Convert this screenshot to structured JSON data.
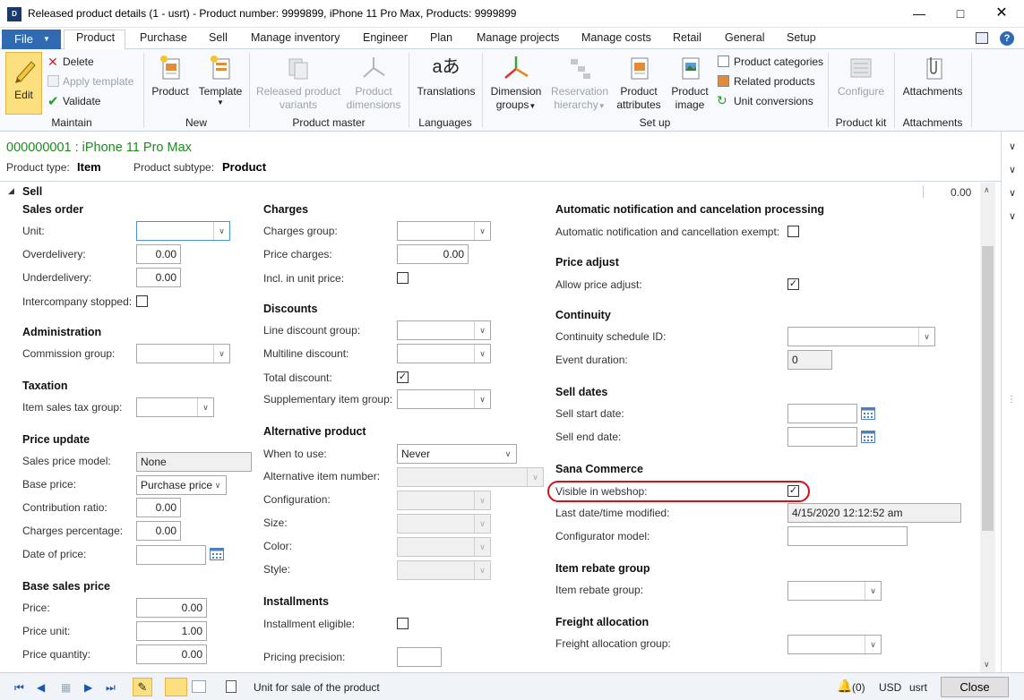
{
  "window": {
    "title": "Released product details (1 - usrt) - Product number: 9999899, iPhone 11 Pro Max, Products: 9999899",
    "icon_label": "D"
  },
  "ribbon_tabs": {
    "file": "File",
    "tabs": [
      "Product",
      "Purchase",
      "Sell",
      "Manage inventory",
      "Engineer",
      "Plan",
      "Manage projects",
      "Manage costs",
      "Retail",
      "General",
      "Setup"
    ]
  },
  "ribbon": {
    "maintain": {
      "label": "Maintain",
      "edit": "Edit",
      "delete": "Delete",
      "apply_template": "Apply template",
      "validate": "Validate"
    },
    "new": {
      "label": "New",
      "product": "Product",
      "template": "Template"
    },
    "product_master": {
      "label": "Product master",
      "variants_1": "Released product",
      "variants_2": "variants",
      "dimensions_1": "Product",
      "dimensions_2": "dimensions"
    },
    "languages": {
      "label": "Languages",
      "translations": "Translations"
    },
    "setup": {
      "label": "Set up",
      "dim_groups_1": "Dimension",
      "dim_groups_2": "groups",
      "res_hier_1": "Reservation",
      "res_hier_2": "hierarchy",
      "attr_1": "Product",
      "attr_2": "attributes",
      "image_1": "Product",
      "image_2": "image",
      "categories": "Product categories",
      "related": "Related products",
      "unit_conv": "Unit conversions"
    },
    "product_kit": {
      "label": "Product kit",
      "configure": "Configure"
    },
    "attachments": {
      "label": "Attachments",
      "attachments": "Attachments"
    }
  },
  "header": {
    "record": "000000001 : iPhone 11 Pro Max",
    "product_type_label": "Product type:",
    "product_type": "Item",
    "product_subtype_label": "Product subtype:",
    "product_subtype": "Product"
  },
  "section": {
    "title": "Sell",
    "total": "0.00"
  },
  "col1": {
    "sales_order": {
      "title": "Sales order",
      "unit": "Unit:",
      "unit_val": "",
      "overdelivery": "Overdelivery:",
      "overdelivery_val": "0.00",
      "underdelivery": "Underdelivery:",
      "underdelivery_val": "0.00",
      "intercompany": "Intercompany stopped:"
    },
    "administration": {
      "title": "Administration",
      "commission": "Commission group:"
    },
    "taxation": {
      "title": "Taxation",
      "item_tax": "Item sales tax group:"
    },
    "price_update": {
      "title": "Price update",
      "model": "Sales price model:",
      "model_val": "None",
      "base": "Base price:",
      "base_val": "Purchase price",
      "contribution": "Contribution ratio:",
      "contribution_val": "0.00",
      "charges_pct": "Charges percentage:",
      "charges_pct_val": "0.00",
      "date": "Date of price:"
    },
    "base_sales_price": {
      "title": "Base sales price",
      "price": "Price:",
      "price_val": "0.00",
      "unit": "Price unit:",
      "unit_val": "1.00",
      "qty": "Price quantity:",
      "qty_val": "0.00"
    }
  },
  "col2": {
    "charges": {
      "title": "Charges",
      "group": "Charges group:",
      "price": "Price charges:",
      "price_val": "0.00",
      "incl": "Incl. in unit price:"
    },
    "discounts": {
      "title": "Discounts",
      "line": "Line discount group:",
      "multiline": "Multiline discount:",
      "total": "Total discount:",
      "supp": "Supplementary item group:"
    },
    "alternative": {
      "title": "Alternative product",
      "when": "When to use:",
      "when_val": "Never",
      "alt_item": "Alternative item number:",
      "config": "Configuration:",
      "size": "Size:",
      "color": "Color:",
      "style": "Style:"
    },
    "installments": {
      "title": "Installments",
      "eligible": "Installment eligible:",
      "precision": "Pricing precision:"
    }
  },
  "col3": {
    "auto": {
      "title": "Automatic notification and cancelation processing",
      "exempt": "Automatic notification and cancellation exempt:"
    },
    "price_adjust": {
      "title": "Price adjust",
      "allow": "Allow price adjust:"
    },
    "continuity": {
      "title": "Continuity",
      "schedule": "Continuity schedule ID:",
      "duration": "Event duration:",
      "duration_val": "0"
    },
    "sell_dates": {
      "title": "Sell dates",
      "start": "Sell start date:",
      "end": "Sell end date:"
    },
    "sana": {
      "title": "Sana Commerce",
      "visible": "Visible in webshop:",
      "modified": "Last date/time modified:",
      "modified_val": "4/15/2020 12:12:52 am",
      "configurator": "Configurator model:"
    },
    "rebate": {
      "title": "Item rebate group",
      "group": "Item rebate group:"
    },
    "freight": {
      "title": "Freight allocation",
      "group": "Freight allocation group:"
    }
  },
  "status": {
    "help_text": "Unit for sale of the product",
    "notifications": "(0)",
    "currency": "USD",
    "company": "usrt",
    "close": "Close"
  },
  "colors": {
    "accent": "#2f6ab3",
    "record_green": "#1e8a1e",
    "highlight_red": "#d0101a"
  }
}
